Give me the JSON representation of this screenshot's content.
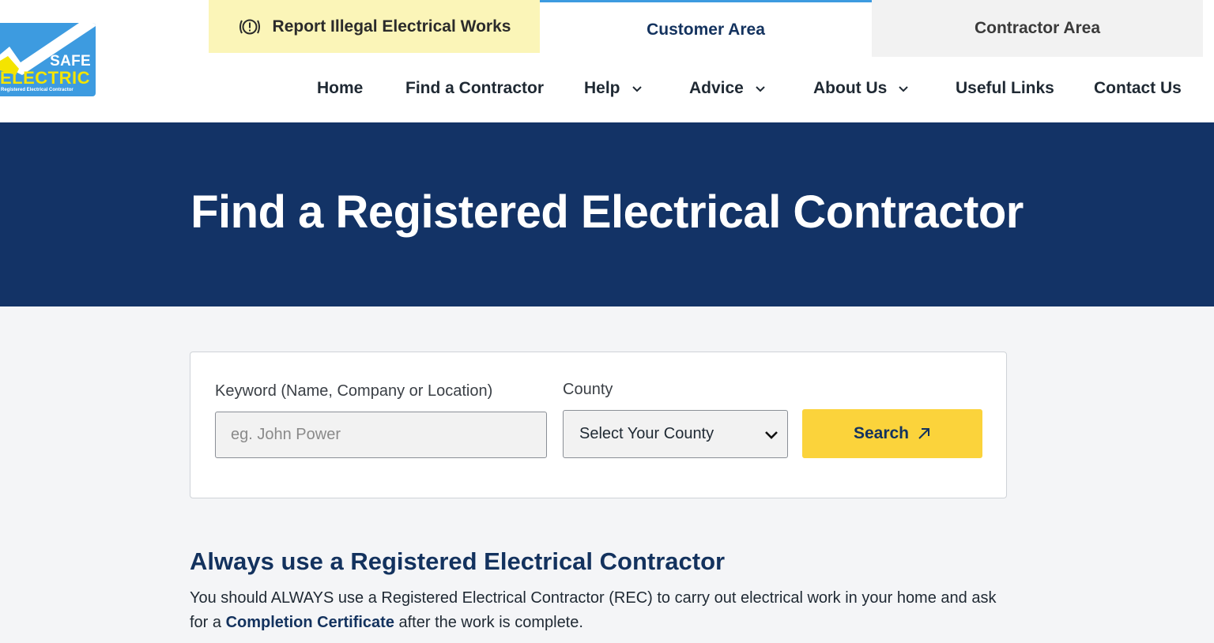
{
  "logo": {
    "safe": "SAFE",
    "electric": "ELECTRIC",
    "tagline": "Registered Electrical Contractor",
    "bg_color": "#3d9be0"
  },
  "top_tabs": {
    "report": "Report Illegal Electrical Works",
    "customer": "Customer Area",
    "contractor": "Contractor Area"
  },
  "nav": {
    "home": "Home",
    "find_contractor": "Find a Contractor",
    "help": "Help",
    "advice": "Advice",
    "about": "About Us",
    "useful_links": "Useful Links",
    "contact": "Contact Us"
  },
  "hero": {
    "title": "Find a Registered Electrical Contractor",
    "bg_color": "#133366"
  },
  "search": {
    "keyword_label": "Keyword (Name, Company or Location)",
    "keyword_placeholder": "eg. John Power",
    "county_label": "County",
    "county_selected": "Select Your County",
    "button_label": "Search",
    "button_color": "#fbd33b"
  },
  "content": {
    "heading": "Always use a Registered Electrical Contractor",
    "para_before": "You should ALWAYS use a Registered Electrical Contractor (REC) to carry out electrical work in your home and ask for a ",
    "para_link": "Completion Certificate",
    "para_after": " after the work is complete."
  }
}
